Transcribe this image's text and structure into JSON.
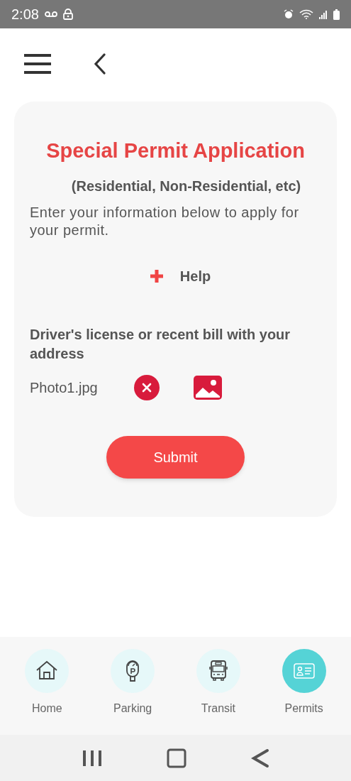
{
  "status_bar": {
    "time": "2:08"
  },
  "card": {
    "title": "Special Permit Application",
    "subtitle": "(Residential, Non-Residential, etc)",
    "intro": "Enter your information below to apply for your permit.",
    "help": "Help",
    "upload_label": "Driver's license or recent bill with your address",
    "file_name": "Photo1.jpg",
    "submit": "Submit"
  },
  "bottom_nav": [
    {
      "label": "Home",
      "selected": false
    },
    {
      "label": "Parking",
      "selected": false
    },
    {
      "label": "Transit",
      "selected": false
    },
    {
      "label": "Permits",
      "selected": true
    }
  ]
}
